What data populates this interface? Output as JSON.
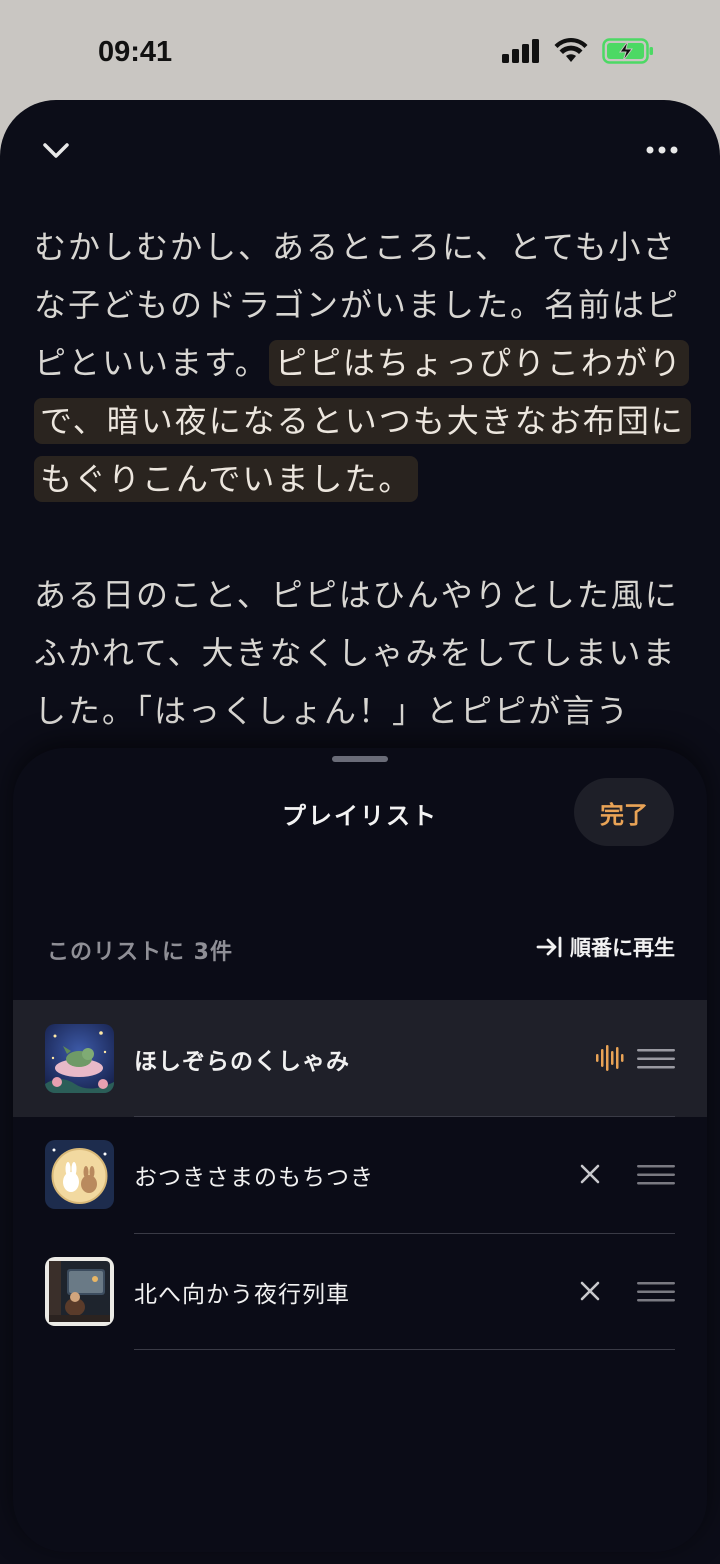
{
  "status_bar": {
    "time": "09:41",
    "icons": [
      "cellular-signal-icon",
      "wifi-icon",
      "battery-charging-icon"
    ]
  },
  "reader": {
    "header_icons": [
      "chevron-down-icon",
      "more-icon"
    ],
    "paragraph1": {
      "plain": "むかしむかし、あるところに、とても小さな子どものドラゴンがいました。名前はピピといいます。",
      "highlighted": "ピピはちょっぴりこわがりで、暗い夜になるといつも大きなお布団にもぐりこんでいました。"
    },
    "paragraph2": "ある日のこと、ピピはひんやりとした風にふかれて、大きなくしゃみをしてしまいました。「はっくしょん！」とピピが言うと、なんと口から本物の星がぽんと飛び出しまし"
  },
  "playlist": {
    "title": "プレイリスト",
    "done_label": "完了",
    "count_label": "このリストに 3件",
    "play_in_order_label": "順番に再生",
    "tracks": [
      {
        "title": "ほしぞらのくしゃみ",
        "state": "playing",
        "thumb_icon": "sleeping-dragon-thumbnail"
      },
      {
        "title": "おつきさまのもちつき",
        "state": "queued",
        "thumb_icon": "moon-rabbits-thumbnail"
      },
      {
        "title": "北へ向かう夜行列車",
        "state": "queued",
        "thumb_icon": "night-train-thumbnail"
      }
    ]
  },
  "colors": {
    "background": "#0c0d18",
    "accent": "#e9a356",
    "highlight": "#2a241f",
    "battery": "#4cd964"
  }
}
